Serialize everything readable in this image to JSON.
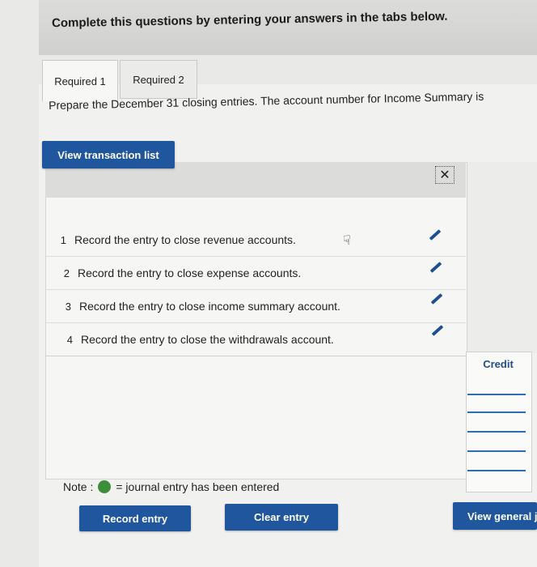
{
  "instructions": "Complete this questions by entering your answers in the tabs below.",
  "tabs": [
    {
      "label": "Required 1",
      "active": true
    },
    {
      "label": "Required 2",
      "active": false
    }
  ],
  "prompt": "Prepare the December 31 closing entries. The account number for Income Summary is",
  "view_transaction_list": "View transaction list",
  "close_symbol": "✕",
  "transactions": [
    {
      "num": "1",
      "text": "Record the entry to close revenue accounts."
    },
    {
      "num": "2",
      "text": "Record the entry to close expense accounts."
    },
    {
      "num": "3",
      "text": "Record the entry to close income summary account."
    },
    {
      "num": "4",
      "text": "Record the entry to close the withdrawals account."
    }
  ],
  "journal_column_header": "Credit",
  "note": {
    "label": "Note :",
    "text": "= journal entry has been entered",
    "dot_color": "#3b8f3b"
  },
  "buttons": {
    "record_entry": "Record entry",
    "clear_entry": "Clear entry",
    "view_general_journal": "View general j"
  },
  "colors": {
    "primary_button": "#20569d",
    "pencil": "#1d4f91"
  }
}
